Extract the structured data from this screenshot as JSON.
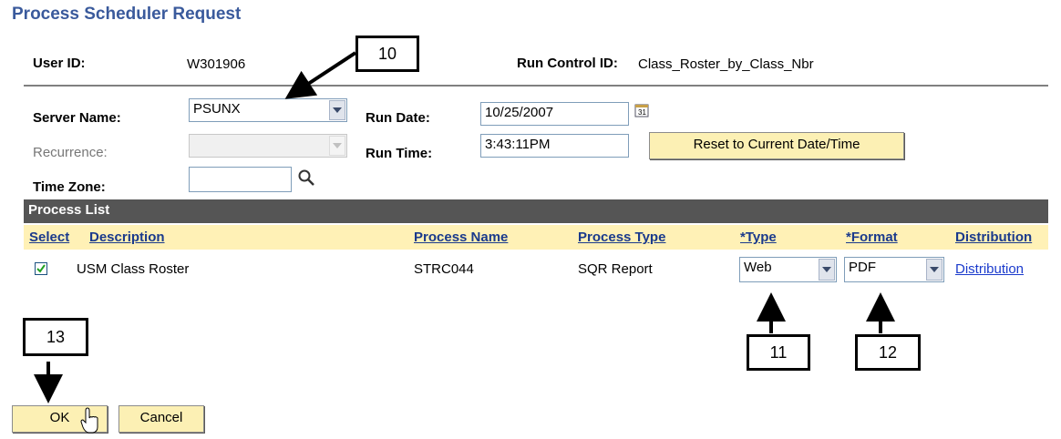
{
  "page_title": "Process Scheduler Request",
  "user_id": {
    "label": "User ID:",
    "value": "W301906"
  },
  "run_control": {
    "label": "Run Control ID:",
    "value": "Class_Roster_by_Class_Nbr"
  },
  "server_name": {
    "label": "Server Name:",
    "value": "PSUNX"
  },
  "run_date": {
    "label": "Run Date:",
    "value": "10/25/2007"
  },
  "recurrence": {
    "label": "Recurrence:",
    "value": ""
  },
  "run_time": {
    "label": "Run Time:",
    "value": "3:43:11PM"
  },
  "reset_button": "Reset to Current Date/Time",
  "time_zone": {
    "label": "Time Zone:",
    "value": ""
  },
  "process_list": {
    "title": "Process List",
    "columns": [
      "Select",
      "Description",
      "Process Name",
      "Process Type",
      "*Type",
      "*Format",
      "Distribution"
    ],
    "rows": [
      {
        "selected": true,
        "description": "USM Class Roster",
        "process_name": "STRC044",
        "process_type": "SQR Report",
        "type": "Web",
        "format": "PDF",
        "distribution": "Distribution"
      }
    ]
  },
  "buttons": {
    "ok": "OK",
    "cancel": "Cancel"
  },
  "callouts": {
    "c10": "10",
    "c11": "11",
    "c12": "12",
    "c13": "13"
  },
  "icons": {
    "calendar": "calendar-icon",
    "lookup": "magnifier-icon",
    "dropdown": "chevron-down-icon",
    "cursor": "hand-pointer-icon"
  },
  "colors": {
    "title": "#3a5a9c",
    "header_bg": "#fff1b6",
    "bar_bg": "#555555",
    "button_bg": "#fcf0b4",
    "link": "#1a3acc"
  }
}
